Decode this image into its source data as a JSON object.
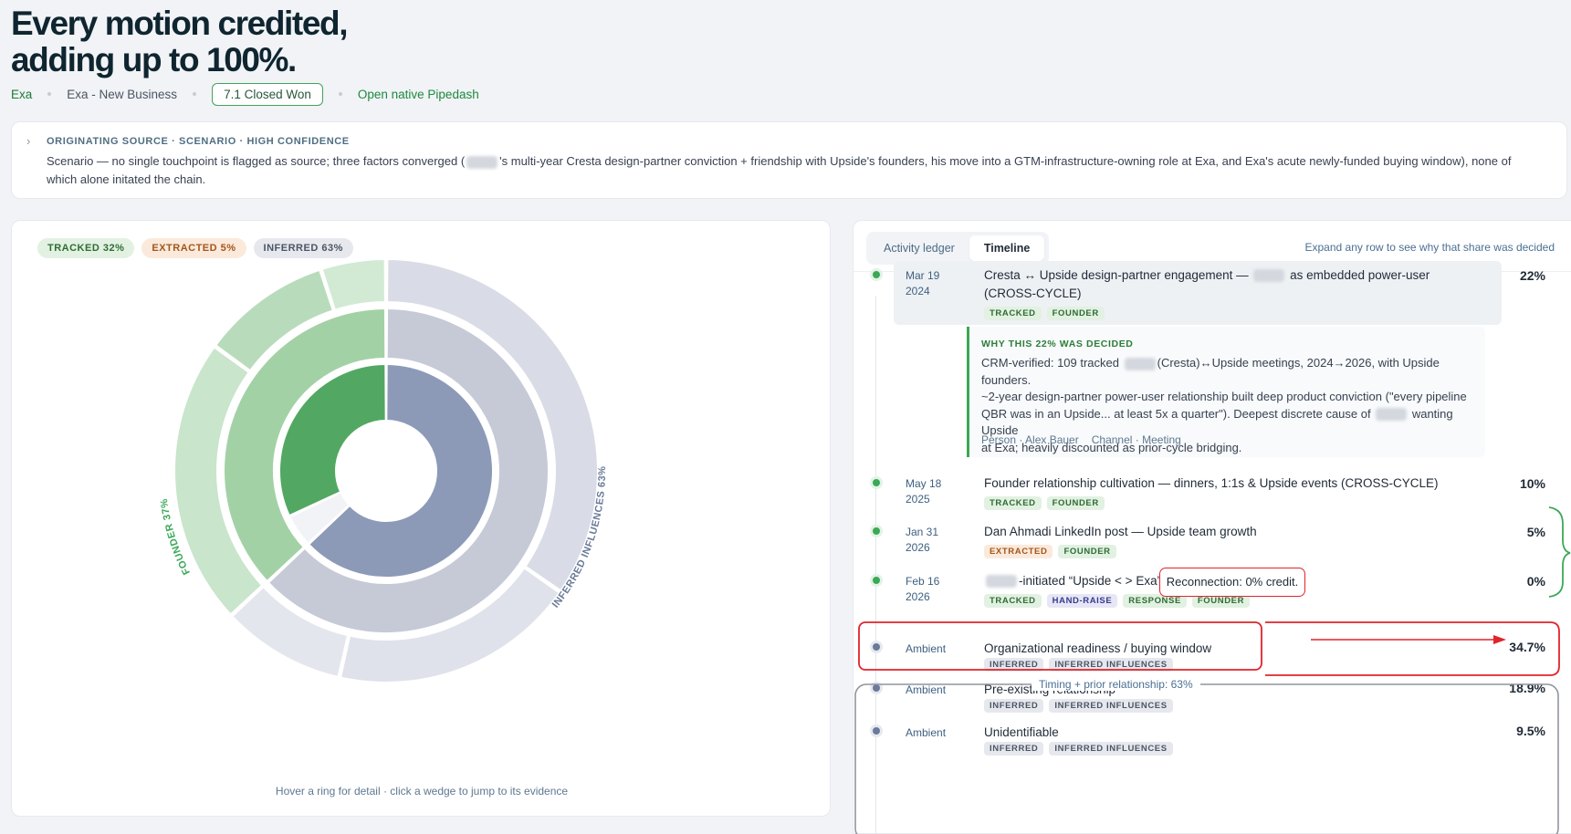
{
  "hero": {
    "title_line1": "Every motion credited,",
    "title_line2": "adding up to 100%."
  },
  "breadcrumbs": {
    "company": "Exa",
    "opportunity": "Exa - New Business",
    "stage": "7.1 Closed Won",
    "open_link": "Open native Pipedash"
  },
  "source": {
    "heading": "ORIGINATING SOURCE · SCENARIO · HIGH CONFIDENCE",
    "text_part1": "Scenario — no single touchpoint is flagged as source; three factors converged (",
    "text_part2": "'s multi-year Cresta design-partner conviction + friendship with Upside's founders, his move into a GTM-infrastructure-owning role at Exa, and Exa's acute newly-funded buying window), none of which alone initated the chain."
  },
  "chart_legend": {
    "tracked": "TRACKED 32%",
    "extracted": "EXTRACTED 5%",
    "inferred": "INFERRED 63%"
  },
  "chart_data": {
    "type": "sunburst",
    "rings": [
      {
        "name": "evidence-type",
        "segments": [
          {
            "label": "Tracked",
            "value": 32,
            "color": "#52a862"
          },
          {
            "label": "Inferred",
            "value": 63,
            "color": "#8c9ab8"
          },
          {
            "label": "Extracted",
            "value": 5,
            "color": "#f1f3f6"
          }
        ]
      },
      {
        "name": "motion",
        "segments": [
          {
            "label": "Founder",
            "value": 37,
            "color": "#a3d1a6"
          },
          {
            "label": "Inferred influences",
            "value": 63,
            "color": "#c5cad6"
          }
        ]
      },
      {
        "name": "touchpoints",
        "segments": [
          {
            "value": 22,
            "color": "#c9e5cb"
          },
          {
            "value": 10,
            "color": "#b8dcbb"
          },
          {
            "value": 5,
            "color": "#d2ead4"
          },
          {
            "value": 34.7,
            "color": "#d9dce6"
          },
          {
            "value": 18.9,
            "color": "#dfe2ea"
          },
          {
            "value": 9.5,
            "color": "#e4e6ed"
          }
        ]
      }
    ],
    "labels": {
      "founder": "FOUNDER 37%",
      "inferred": "INFERRED INFLUENCES 63%"
    }
  },
  "chart_hint": "Hover a ring for detail · click a wedge to jump to its evidence",
  "tabs": [
    "Activity ledger",
    "Timeline"
  ],
  "expand_hint": "Expand any row to see why that share was decided",
  "timeline": [
    {
      "date_line1": "Mar 19",
      "date_line2": "2024",
      "title_part1": "Cresta ↔ Upside design-partner engagement — ",
      "title_part2": " as embedded power-user",
      "title_line2": "(CROSS-CYCLE)",
      "pct": "22%",
      "tags": [
        "TRACKED",
        "FOUNDER"
      ]
    },
    {
      "date_line1": "May 18",
      "date_line2": "2025",
      "title": "Founder relationship cultivation — dinners, 1:1s & Upside events (CROSS-CYCLE)",
      "pct": "10%",
      "tags": [
        "TRACKED",
        "FOUNDER"
      ]
    },
    {
      "date_line1": "Jan 31",
      "date_line2": "2026",
      "title": "Dan Ahmadi LinkedIn post — Upside team growth",
      "pct": "5%",
      "tags": [
        "EXTRACTED",
        "FOUNDER"
      ]
    },
    {
      "date_line1": "Feb 16",
      "date_line2": "2026",
      "title": "-initiated “Upside < > Exa” reconnection",
      "pct": "0%",
      "tags": [
        "TRACKED",
        "HAND-RAISE",
        "RESPONSE",
        "FOUNDER"
      ]
    },
    {
      "date_line1": "Ambient",
      "title": "Organizational readiness / buying window",
      "pct": "34.7%",
      "tags": [
        "INFERRED",
        "INFERRED INFLUENCES"
      ]
    },
    {
      "date_line1": "Ambient",
      "title": "Pre-existing relationship",
      "pct": "18.9%",
      "tags": [
        "INFERRED",
        "INFERRED INFLUENCES"
      ]
    },
    {
      "date_line1": "Ambient",
      "title": "Unidentifiable",
      "pct": "9.5%",
      "tags": [
        "INFERRED",
        "INFERRED INFLUENCES"
      ]
    }
  ],
  "why": {
    "title": "WHY THIS 22% WAS DECIDED",
    "line1_part1": "CRM-verified: 109 tracked ",
    "line1_part2": "(Cresta)↔Upside meetings, 2024→2026, with Upside founders.",
    "line2": "~2-year design-partner power-user relationship built deep product conviction (\"every pipeline",
    "line3_part1": "QBR was in an Upside... at least 5x a quarter\"). Deepest discrete cause of ",
    "line3_part2": " wanting Upside",
    "line4": "at Exa; heavily discounted as prior-cycle bridging.",
    "person": "Person · Alex Bauer",
    "channel": "Channel · Meeting"
  },
  "annotations": {
    "reconnection": "Reconnection: 0% credit.",
    "timing": "Timing + prior relationship: 63%"
  },
  "colors": {
    "accent_green": "#3aa957",
    "annotation_red": "#e0242b",
    "slate": "#6b7a99"
  }
}
